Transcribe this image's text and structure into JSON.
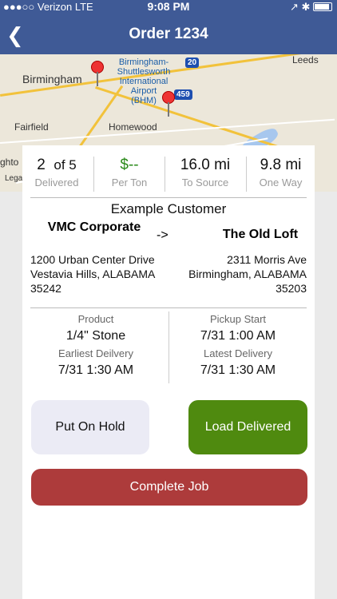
{
  "status_bar": {
    "carrier": "●●●○○ Verizon  LTE",
    "time": "9:08 PM",
    "right_icons": "↗ ✱"
  },
  "header": {
    "title": "Order 1234",
    "back_icon": "chevron-left-icon"
  },
  "map": {
    "labels": {
      "birmingham": "Birmingham",
      "airport": "Birmingham-\nShuttlesworth\nInternational\nAirport\n(BHM)",
      "fairfield": "Fairfield",
      "homewood": "Homewood",
      "leeds": "Leeds",
      "partial_left1": "ghto",
      "partial_left2": "Lega",
      "i20": "20",
      "i459": "459"
    }
  },
  "stats": [
    {
      "value_main": "2",
      "value_suffix": "of 5",
      "label": "Delivered"
    },
    {
      "value": "$--",
      "label": "Per Ton",
      "color": "#2a8a1a"
    },
    {
      "value": "16.0 mi",
      "label": "To Source"
    },
    {
      "value": "9.8 mi",
      "label": "One Way"
    }
  ],
  "customer": "Example Customer",
  "from": {
    "name": "VMC Corporate",
    "address_line1": "1200 Urban Center Drive",
    "address_line2": "Vestavia Hills, ALABAMA",
    "zip": "35242"
  },
  "arrow": "->",
  "to": {
    "name": "The Old Loft",
    "address_line1": "2311 Morris Ave",
    "address_line2": "Birmingham, ALABAMA",
    "zip": "35203"
  },
  "details": {
    "product_label": "Product",
    "product_value": "1/4\" Stone",
    "earliest_label": "Earliest Deilvery",
    "earliest_value": "7/31 1:30 AM",
    "pickup_label": "Pickup Start",
    "pickup_value": "7/31 1:00 AM",
    "latest_label": "Latest Delivery",
    "latest_value": "7/31 1:30 AM"
  },
  "buttons": {
    "hold": "Put On Hold",
    "delivered": "Load Delivered",
    "complete": "Complete Job"
  },
  "colors": {
    "header": "#3f5a96",
    "delivered": "#4f8a0f",
    "complete": "#ad3b3b",
    "hold": "#ebebf5"
  }
}
